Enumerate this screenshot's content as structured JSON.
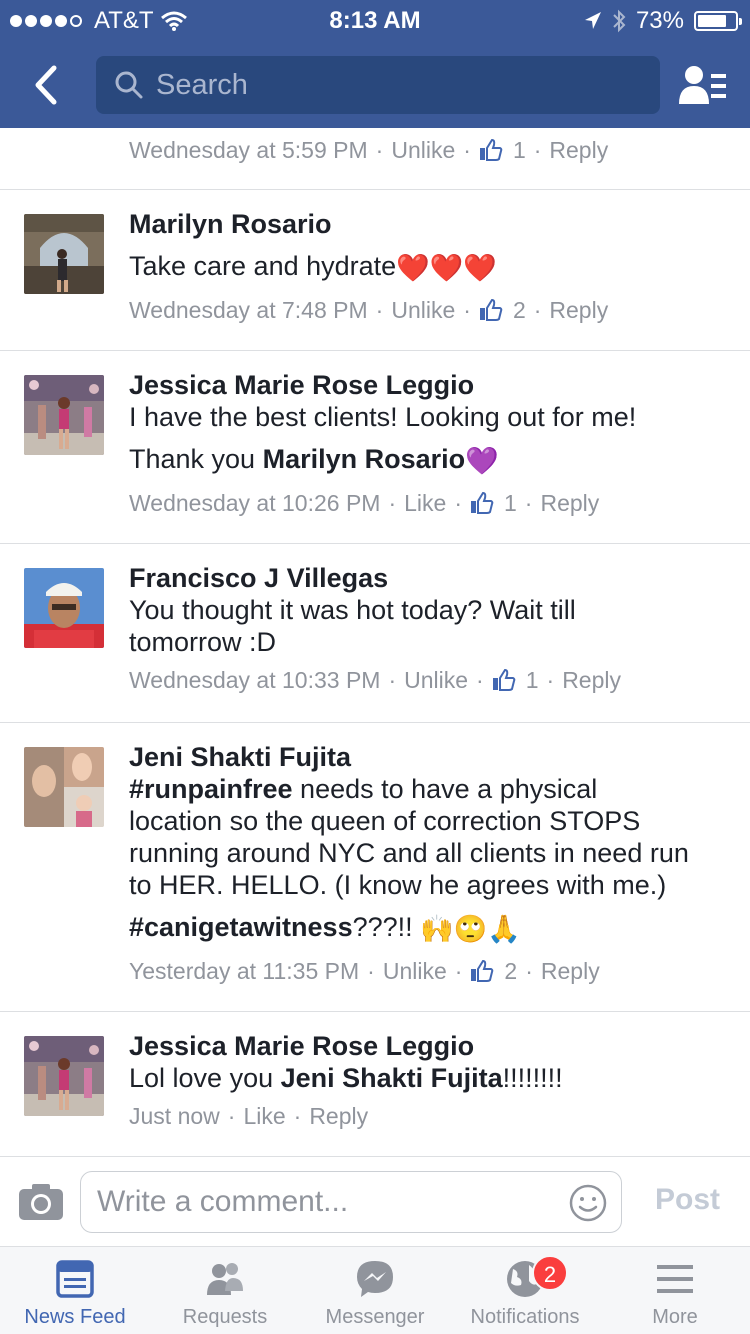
{
  "status_bar": {
    "carrier": "AT&T",
    "time": "8:13 AM",
    "battery": "73%",
    "signal_bars_filled": 4,
    "signal_bars_total": 5
  },
  "nav": {
    "search_placeholder": "Search"
  },
  "first_comment_meta": {
    "time": "Wednesday at 5:59 PM",
    "action": "Unlike",
    "likes": "1",
    "reply": "Reply"
  },
  "comments": [
    {
      "author": "Marilyn Rosario",
      "text": "Take care and hydrate",
      "emoji": "❤️❤️❤️",
      "time": "Wednesday at 7:48 PM",
      "action": "Unlike",
      "likes": "2",
      "reply": "Reply"
    },
    {
      "author": "Jessica Marie Rose Leggio",
      "line1": "I have the best clients! Looking out for me!",
      "line2_prefix": "Thank you ",
      "line2_mention": "Marilyn Rosario",
      "emoji": "💜",
      "time": "Wednesday at 10:26 PM",
      "action": "Like",
      "likes": "1",
      "reply": "Reply"
    },
    {
      "author": "Francisco J Villegas",
      "line1": "You thought it was hot today? Wait till",
      "line2": "tomorrow :D",
      "time": "Wednesday at 10:33 PM",
      "action": "Unlike",
      "likes": "1",
      "reply": "Reply"
    },
    {
      "author": "Jeni Shakti Fujita",
      "hashtag1": "#runpainfree",
      "line1_rest": " needs to have a physical",
      "line2": "location so the queen of correction STOPS",
      "line3": "running around NYC and all clients in need run",
      "line4": "to HER. HELLO. (I know he agrees with me.)",
      "hashtag2": "#canigetawitness",
      "line5_rest": "???!! ",
      "emoji": "🙌🙄🙏",
      "time": "Yesterday at 11:35 PM",
      "action": "Unlike",
      "likes": "2",
      "reply": "Reply"
    },
    {
      "author": "Jessica Marie Rose Leggio",
      "prefix": "Lol love you ",
      "mention": "Jeni Shakti Fujita",
      "suffix": "!!!!!!!!",
      "time": "Just now",
      "action": "Like",
      "reply": "Reply"
    }
  ],
  "composer": {
    "placeholder": "Write a comment...",
    "post_label": "Post"
  },
  "tabs": [
    {
      "label": "News Feed",
      "icon": "news-feed-icon",
      "active": true
    },
    {
      "label": "Requests",
      "icon": "requests-icon"
    },
    {
      "label": "Messenger",
      "icon": "messenger-icon"
    },
    {
      "label": "Notifications",
      "icon": "globe-icon",
      "badge": "2"
    },
    {
      "label": "More",
      "icon": "menu-icon"
    }
  ],
  "colors": {
    "brand_blue": "#3b5998",
    "search_bg": "#29487d",
    "like_blue": "#4267b2",
    "meta_gray": "#90949c",
    "badge_red": "#fa3e3e"
  }
}
